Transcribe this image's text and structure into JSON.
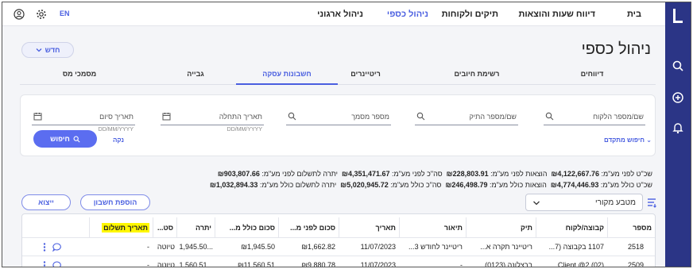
{
  "nav": {
    "items": [
      "בית",
      "דיווח שעות והוצאות",
      "תיקים ולקוחות",
      "ניהול כספי",
      "ניהול ארגוני"
    ],
    "active": "ניהול כספי",
    "lang": "EN"
  },
  "page": {
    "title": "ניהול כספי",
    "new_button": "חדש"
  },
  "tabs": [
    "דיווחים",
    "רשימת חיובים",
    "ריטיינרים",
    "חשבונות עסקה",
    "גבייה",
    "מסמכי מס"
  ],
  "active_tab": "חשבונות עסקה",
  "search": {
    "client": "שם/מספר הלקוח",
    "case": "שם/מספר התיק",
    "doc": "מספר מסמך",
    "start_date": "תאריך התחלה",
    "end_date": "תאריך סיום",
    "date_hint": "DD/MM/YYYY",
    "advanced": "חיפוש מתקדם",
    "clear": "נקה",
    "search_button": "חיפוש"
  },
  "totals": {
    "row1": [
      {
        "label": "שכ\"ט לפני מע\"מ:",
        "value": "₪4,122,667.76"
      },
      {
        "label": "הוצאות לפני מע\"מ:",
        "value": "₪228,803.91"
      },
      {
        "label": "סה\"כ לפני מע\"מ:",
        "value": "₪4,351,471.67"
      },
      {
        "label": "יתרה לתשלום לפני מע\"מ:",
        "value": "₪903,807.66"
      }
    ],
    "row2": [
      {
        "label": "שכ\"ט כולל מע\"מ:",
        "value": "₪4,774,446.93"
      },
      {
        "label": "הוצאות כולל מע\"מ:",
        "value": "₪246,498.79"
      },
      {
        "label": "סה\"כ כולל מע\"מ:",
        "value": "₪5,020,945.72"
      },
      {
        "label": "יתרה לתשלום כולל מע\"מ:",
        "value": "₪1,032,894.33"
      }
    ]
  },
  "actions": {
    "currency_select": "מטבע מקורי",
    "add_account": "הוספת חשבון",
    "export": "ייצוא"
  },
  "table": {
    "columns": [
      "מספר",
      "קבוצה/לקוח",
      "תיק",
      "תיאור",
      "תאריך",
      "סכום לפני מ...",
      "סכום כולל מ...",
      "יתרה",
      "סט...",
      "תאריך תשלום"
    ],
    "rows": [
      [
        "2518",
        "1107 בקבוצה (7...",
        "ריטיינר תקרה א...",
        "ריטיינר לחודש 3...",
        "11/07/2023",
        "₪1,662.82",
        "₪1,945.50",
        "...1,945.50",
        "טיוטה",
        "-"
      ],
      [
        "2509",
        "Client @2 (02)...",
        "ברצלונה (0123)",
        "-",
        "11/07/2023",
        "₪9,880.78",
        "₪11,560.51",
        "...1,560.51",
        "טיוטה",
        "-"
      ]
    ]
  },
  "colors": {
    "sidebar": "#2b3586",
    "accent": "#4a5fe0",
    "highlight": "#fff700"
  }
}
